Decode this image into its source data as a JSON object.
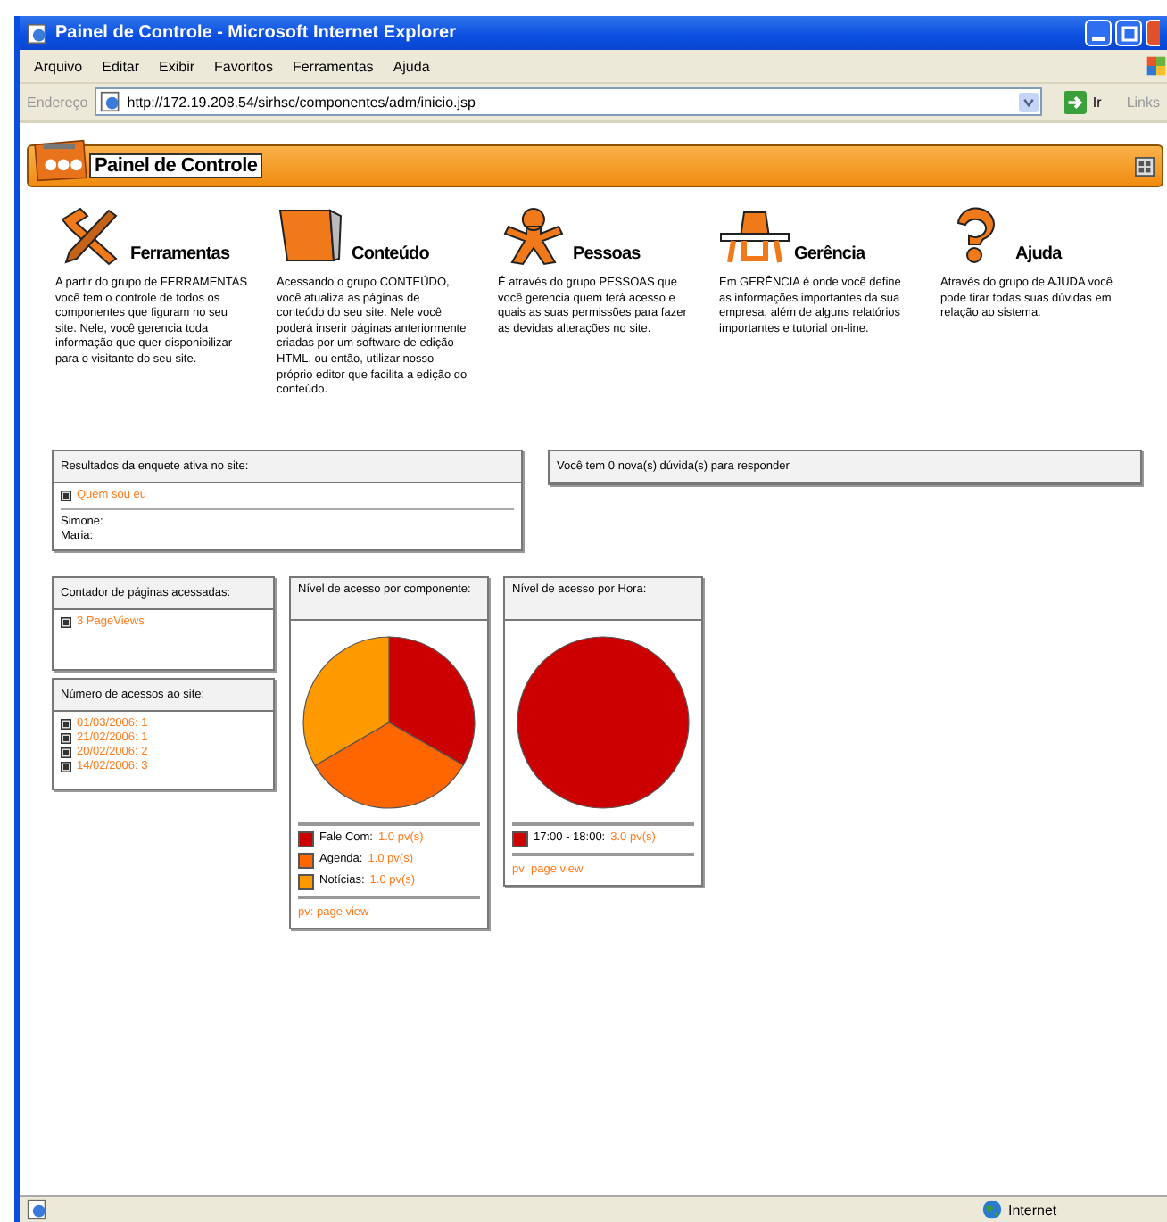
{
  "window": {
    "title": "Painel de Controle - Microsoft Internet Explorer"
  },
  "menu": [
    "Arquivo",
    "Editar",
    "Exibir",
    "Favoritos",
    "Ferramentas",
    "Ajuda"
  ],
  "address": {
    "label": "Endereço",
    "value": "http://172.19.208.54/sirhsc/componentes/adm/inicio.jsp",
    "go": "Ir",
    "links": "Links"
  },
  "header": {
    "title": "Painel de Controle"
  },
  "sections": [
    {
      "kind": "tools",
      "title": "Ferramentas",
      "description": "A partir do grupo de FERRAMENTAS você tem o controle de todos os componentes que figuram no seu site. Nele, você gerencia toda informação que quer disponibilizar para o visitante do seu site."
    },
    {
      "kind": "folder",
      "title": "Conteúdo",
      "description": "Acessando o grupo CONTEÚDO, você atualiza as páginas de conteúdo do seu site. Nele você poderá inserir páginas anteriormente criadas por um software de edição HTML, ou então, utilizar nosso próprio editor que facilita a edição do conteúdo."
    },
    {
      "kind": "person",
      "title": "Pessoas",
      "description": "É através do grupo PESSOAS que você gerencia quem terá acesso e quais as suas permissões para fazer as devidas alterações no site."
    },
    {
      "kind": "desk",
      "title": "Gerência",
      "description": "Em GERÊNCIA é onde você define as informações importantes da sua empresa, além de alguns relatórios importantes e tutorial on-line."
    },
    {
      "kind": "help",
      "title": "Ajuda",
      "description": "Através do grupo de AJUDA você pode tirar todas suas dúvidas em relação ao sistema."
    }
  ],
  "poll": {
    "title": "Resultados da enquete ativa no site:",
    "question": "Quem sou eu",
    "answers": [
      "Simone:",
      "Maria:"
    ]
  },
  "questions": {
    "text": "Você tem 0 nova(s) dúvida(s) para responder"
  },
  "page_counter": {
    "title": "Contador de páginas acessadas:",
    "link": "3 PageViews"
  },
  "access_count": {
    "title": "Número de acessos ao site:",
    "entries": [
      "01/03/2006: 1",
      "21/02/2006: 1",
      "20/02/2006: 2",
      "14/02/2006: 3"
    ]
  },
  "charts": [
    {
      "title": "Nível de acesso por componente:",
      "chart_data": {
        "type": "pie",
        "values": [
          33.3,
          33.3,
          33.4
        ]
      },
      "legend": [
        {
          "label": "Fale Com:",
          "value": "1.0 pv(s)",
          "color": "#cc0000"
        },
        {
          "label": "Agenda:",
          "value": "1.0 pv(s)",
          "color": "#ff6600"
        },
        {
          "label": "Notícias:",
          "value": "1.0 pv(s)",
          "color": "#ff9900"
        }
      ],
      "note": "pv: page view"
    },
    {
      "title": "Nível de acesso por Hora:",
      "chart_data": {
        "type": "pie",
        "values": [
          100
        ]
      },
      "legend": [
        {
          "label": "17:00 - 18:00:",
          "value": "3.0 pv(s)",
          "color": "#cc0000"
        }
      ],
      "note": "pv: page view"
    }
  ],
  "status_bar": {
    "zone": "Internet"
  }
}
